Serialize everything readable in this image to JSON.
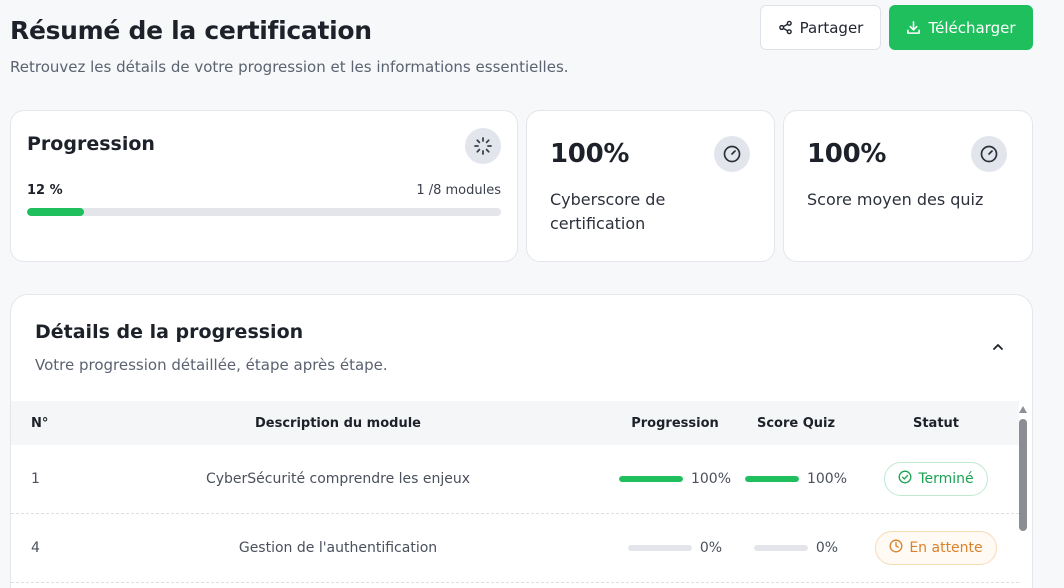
{
  "header": {
    "title": "Résumé de la certification",
    "subtitle": "Retrouvez les détails de votre progression et les informations essentielles.",
    "share_label": "Partager",
    "download_label": "Télécharger"
  },
  "progress_card": {
    "title": "Progression",
    "percent_label": "12 %",
    "percent_value": 12,
    "modules_label": "1 /8 modules",
    "icon": "loader-icon"
  },
  "metrics": [
    {
      "value": "100%",
      "label": "Cyberscore de certification",
      "icon": "gauge-icon"
    },
    {
      "value": "100%",
      "label": "Score moyen des quiz",
      "icon": "gauge-icon"
    }
  ],
  "details": {
    "title": "Détails de la progression",
    "subtitle": "Votre progression détaillée, étape après étape.",
    "columns": {
      "num": "N°",
      "description": "Description du module",
      "progression": "Progression",
      "quiz": "Score Quiz",
      "status": "Statut"
    },
    "rows": [
      {
        "num": "1",
        "description": "CyberSécurité comprendre les enjeux",
        "progress_label": "100%",
        "progress_value": 100,
        "quiz_label": "100%",
        "quiz_value": 100,
        "status": "Terminé"
      },
      {
        "num": "4",
        "description": "Gestion de l'authentification",
        "progress_label": "0%",
        "progress_value": 0,
        "quiz_label": "0%",
        "quiz_value": 0,
        "status": "En attente"
      }
    ]
  },
  "colors": {
    "accent": "#1fbf5e",
    "pending": "#d9822b"
  }
}
